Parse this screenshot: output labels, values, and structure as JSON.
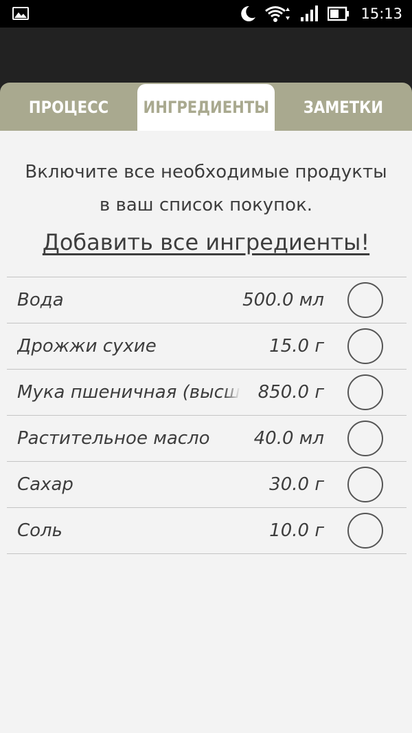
{
  "status_bar": {
    "time": "15:13",
    "icons": [
      "gallery-icon",
      "moon-icon",
      "wifi-icon",
      "signal-icon",
      "battery-icon"
    ]
  },
  "tabs": [
    {
      "label": "ПРОЦЕСС",
      "active": false
    },
    {
      "label": "ИНГРЕДИЕНТЫ",
      "active": true
    },
    {
      "label": "ЗАМЕТКИ",
      "active": false
    }
  ],
  "hint_line1": "Включите все необходимые продукты",
  "hint_line2": "в ваш список покупок.",
  "add_all_label": "Добавить все ингредиенты!",
  "ingredients": [
    {
      "name": "Вода",
      "amount": "500.0 мл",
      "checked": false
    },
    {
      "name": "Дрожжи сухие",
      "amount": "15.0 г",
      "checked": false
    },
    {
      "name": "Мука пшеничная (высш",
      "amount": "850.0 г",
      "checked": false
    },
    {
      "name": "Растительное масло",
      "amount": "40.0 мл",
      "checked": false
    },
    {
      "name": "Сахар",
      "amount": "30.0 г",
      "checked": false
    },
    {
      "name": "Соль",
      "amount": "10.0 г",
      "checked": false
    }
  ],
  "colors": {
    "tab_bar": "#a9a98f",
    "action_bar": "#222222",
    "background": "#f3f3f3",
    "text": "#3d3d3d"
  }
}
